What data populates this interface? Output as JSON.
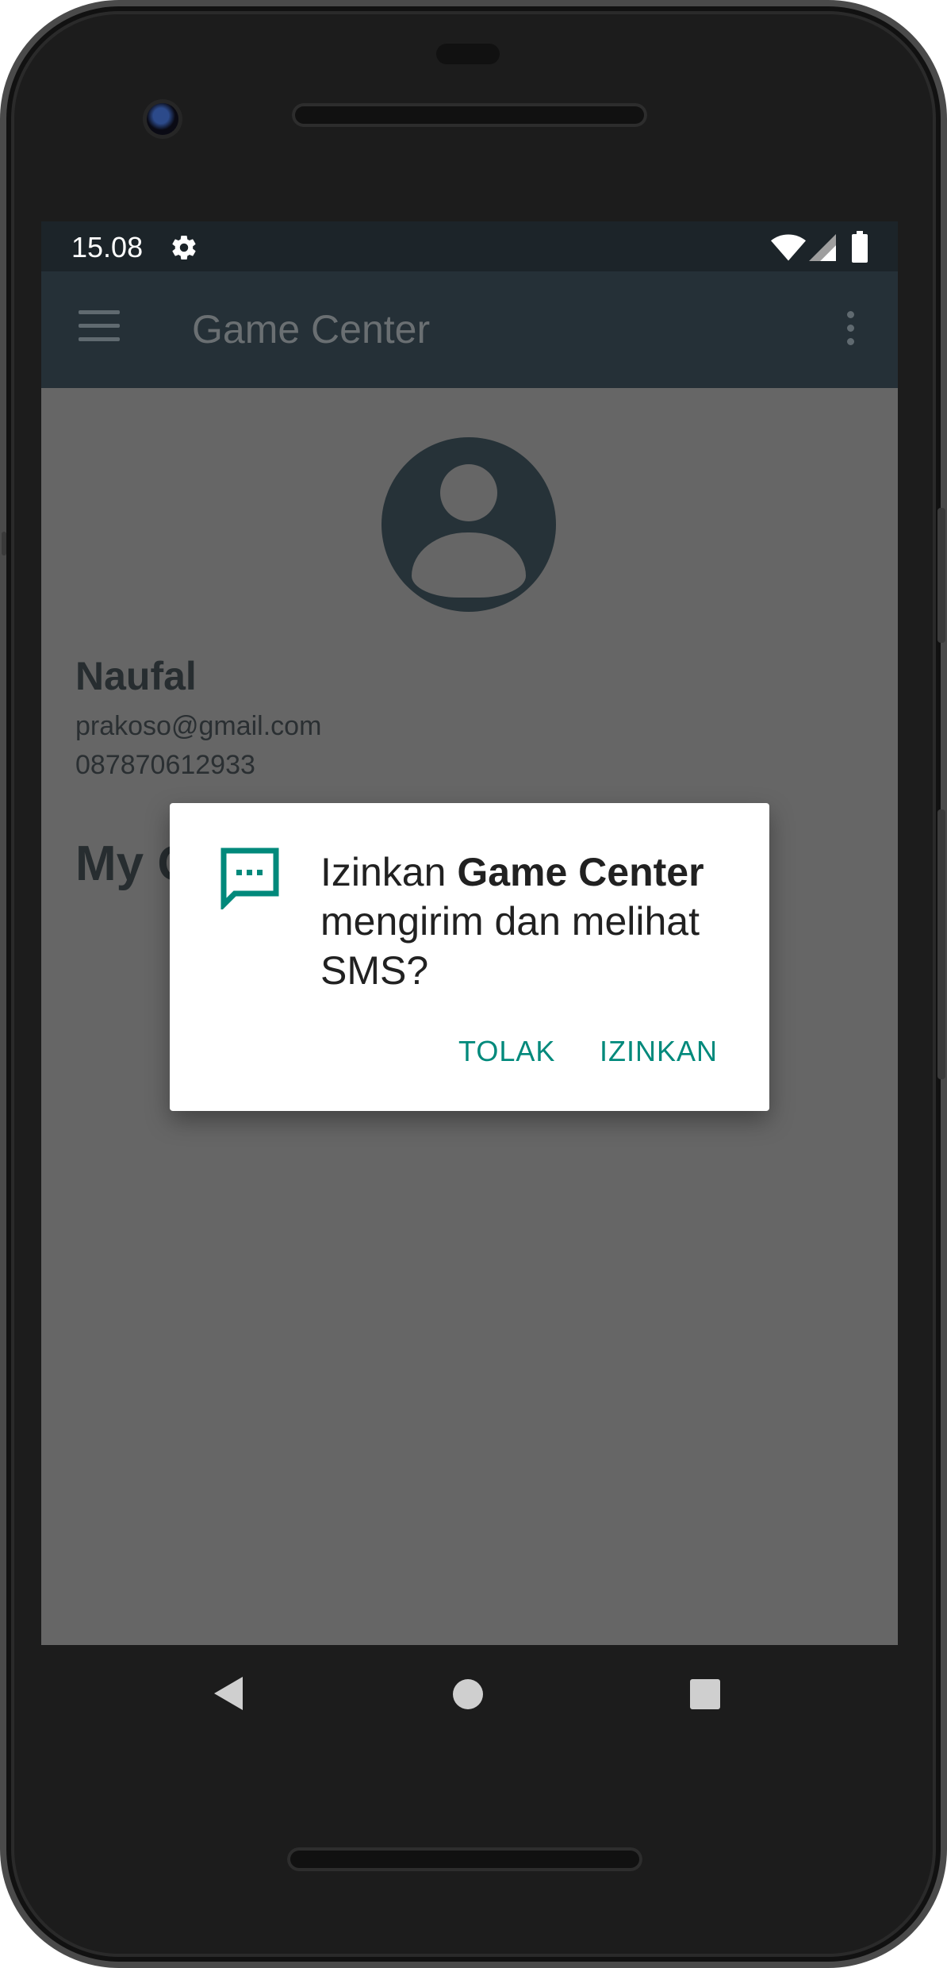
{
  "status_bar": {
    "time": "15.08",
    "icons": [
      "gear-icon",
      "wifi-icon",
      "cellular-signal-icon",
      "battery-icon"
    ]
  },
  "app_bar": {
    "title": "Game Center",
    "nav_icon": "menu-icon",
    "overflow_icon": "more-vert-icon"
  },
  "profile": {
    "avatar_icon": "account-circle-icon",
    "name": "Naufal",
    "email": "prakoso@gmail.com",
    "phone": "087870612933",
    "section_title": "My G"
  },
  "dialog": {
    "icon": "sms-icon",
    "message_prefix": "Izinkan ",
    "app_name": "Game Center",
    "message_suffix": " mengirim dan melihat SMS?",
    "deny_label": "TOLAK",
    "allow_label": "IZINKAN",
    "accent_color": "#00897b"
  },
  "nav_bar": {
    "buttons": [
      "back-icon",
      "home-icon",
      "recents-icon"
    ]
  },
  "colors": {
    "status_bar": "#1c2429",
    "app_bar": "#253037",
    "scrim_background": "#666666",
    "avatar": "#263238"
  }
}
